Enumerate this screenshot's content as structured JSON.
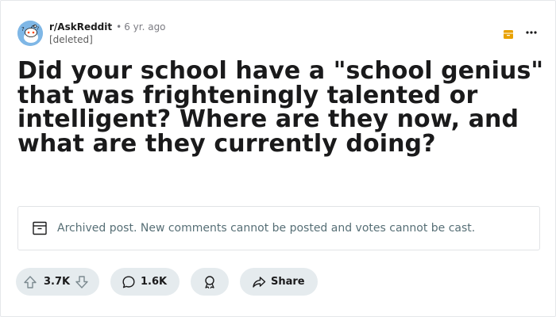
{
  "post": {
    "subreddit": "r/AskReddit",
    "separator": "•",
    "age": "6 yr. ago",
    "author": "[deleted]",
    "title": "Did your school have a \"school genius\" that was frighteningly talented or intelligent? Where are they now, and what are they currently doing?",
    "archived_notice": "Archived post. New comments cannot be posted and votes cannot be cast."
  },
  "actions": {
    "score": "3.7K",
    "comments": "1.6K",
    "share_label": "Share"
  },
  "icons": {
    "avatar": "reddit-snoo-avatar",
    "archive_badge": "archive-box-icon",
    "more": "ellipsis-icon",
    "notice": "archive-box-icon",
    "upvote": "arrow-up-icon",
    "downvote": "arrow-down-icon",
    "comment": "speech-bubble-icon",
    "award": "award-icon",
    "share": "share-arrow-icon"
  },
  "colors": {
    "archive_badge": "#e8a100",
    "avatar_bg": "#7fb7e6",
    "pill_bg": "#e5ebee",
    "notice_text": "#576f76"
  }
}
